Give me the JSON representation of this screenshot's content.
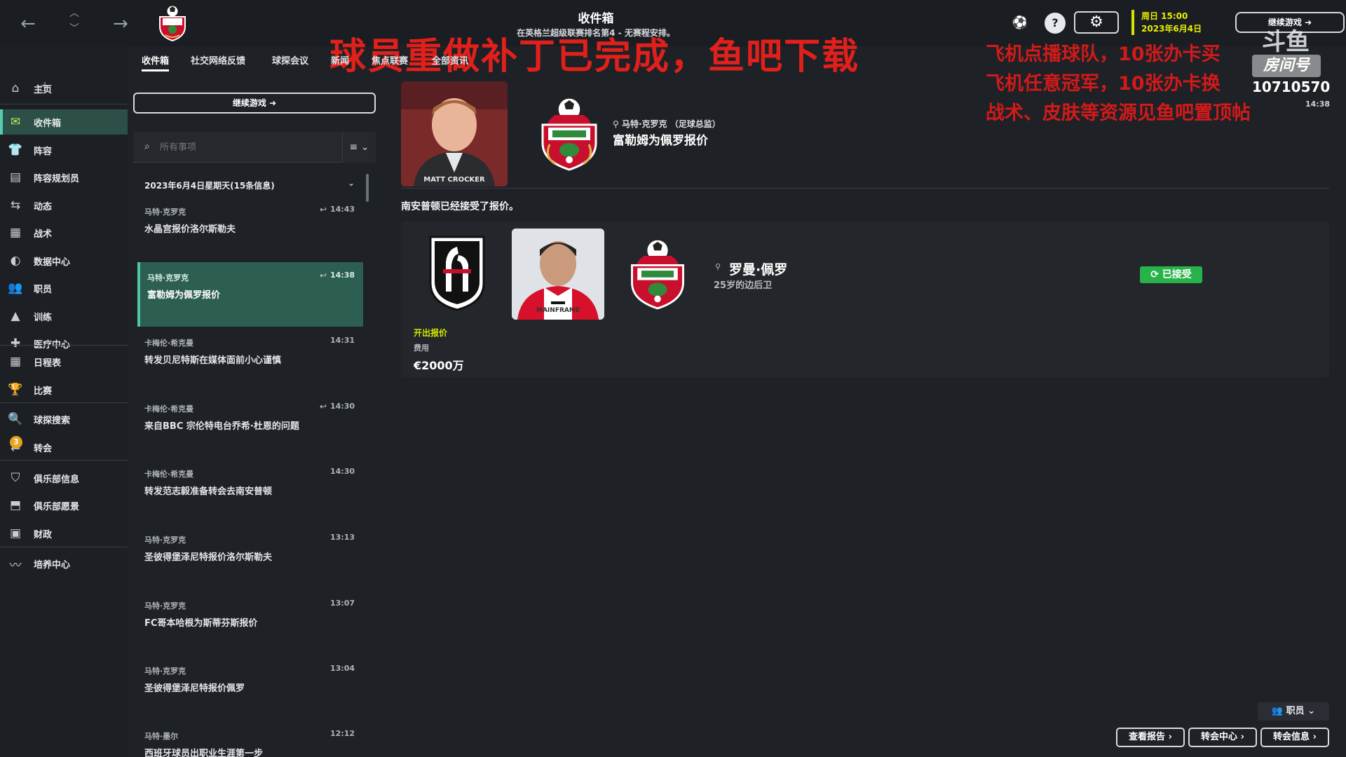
{
  "header": {
    "title": "收件箱",
    "subtitle": "在英格兰超级联赛排名第4 - 无赛程安排。",
    "date_line1": "周日 15:00",
    "date_line2": "2023年6月4日",
    "continue_label": "继续游戏",
    "help_label": "?",
    "icons": [
      "back-icon",
      "forward-icon",
      "up-icon",
      "down-icon",
      "club-crest-icon",
      "football-icon",
      "help-icon",
      "gear-icon"
    ]
  },
  "overlay": {
    "promo_main": "球员重做补丁已完成，鱼吧下载",
    "promo_lines": [
      "飞机点播球队，10张办卡买",
      "飞机任意冠军，10张办卡换",
      "战术、皮肤等资源见鱼吧置顶帖"
    ],
    "logo_text": "斗鱼",
    "room_label": "房间号",
    "room_number": "10710570",
    "room_time": "14:38"
  },
  "sidebar": {
    "items": [
      {
        "label": "主页",
        "icon": "home-icon"
      },
      {
        "label": "收件箱",
        "icon": "inbox-icon"
      },
      {
        "label": "阵容",
        "icon": "shirt-icon"
      },
      {
        "label": "阵容规划员",
        "icon": "clipboard-icon"
      },
      {
        "label": "动态",
        "icon": "dynamics-icon"
      },
      {
        "label": "战术",
        "icon": "tactics-icon"
      },
      {
        "label": "数据中心",
        "icon": "data-icon"
      },
      {
        "label": "职员",
        "icon": "staff-icon"
      },
      {
        "label": "训练",
        "icon": "training-icon"
      },
      {
        "label": "医疗中心",
        "icon": "medical-icon"
      },
      {
        "label": "日程表",
        "icon": "calendar-icon"
      },
      {
        "label": "比赛",
        "icon": "trophy-icon"
      },
      {
        "label": "球探搜索",
        "icon": "search-icon"
      },
      {
        "label": "转会",
        "icon": "transfer-icon",
        "badge": "3"
      },
      {
        "label": "俱乐部信息",
        "icon": "shield-icon"
      },
      {
        "label": "俱乐部愿景",
        "icon": "vision-icon"
      },
      {
        "label": "财政",
        "icon": "finance-icon"
      },
      {
        "label": "培养中心",
        "icon": "development-icon"
      }
    ]
  },
  "tabs": [
    "收件箱",
    "社交网络反馈",
    "球探会议",
    "新闻",
    "焦点联赛",
    "全部资讯"
  ],
  "inbox": {
    "continue_label": "继续游戏",
    "search_placeholder": "所有事项",
    "filter_label": "≡",
    "date_header": "2023年6月4日星期天(15条信息)",
    "messages": [
      {
        "sender": "马特·克罗克",
        "subject": "水晶宫报价洛尔斯勒夫",
        "time": "14:43",
        "reply": true
      },
      {
        "sender": "马特·克罗克",
        "subject": "富勒姆为佩罗报价",
        "time": "14:38",
        "reply": true,
        "active": true
      },
      {
        "sender": "卡梅伦·希克曼",
        "subject": "转发贝尼特斯在媒体面前小心谨慎",
        "time": "14:31",
        "reply": false
      },
      {
        "sender": "卡梅伦·希克曼",
        "subject": "来自BBC 宗伦特电台乔希·杜恩的问题",
        "time": "14:30",
        "reply": true
      },
      {
        "sender": "卡梅伦·希克曼",
        "subject": "转发范志毅准备转会去南安普顿",
        "time": "14:30",
        "reply": false
      },
      {
        "sender": "马特·克罗克",
        "subject": "圣彼得堡泽尼特报价洛尔斯勒夫",
        "time": "13:13",
        "reply": false
      },
      {
        "sender": "马特·克罗克",
        "subject": "FC哥本哈根为斯蒂芬斯报价",
        "time": "13:07",
        "reply": false
      },
      {
        "sender": "马特·克罗克",
        "subject": "圣彼得堡泽尼特报价佩罗",
        "time": "13:04",
        "reply": false
      },
      {
        "sender": "马特·墨尔",
        "subject": "西班牙球员出职业生涯第一步",
        "time": "12:12",
        "reply": false
      }
    ]
  },
  "detail": {
    "portrait_caption": "MATT CROCKER",
    "from": "马特·克罗克 （足球总监）",
    "title": "富勒姆为佩罗报价",
    "body": "南安普顿已经接受了报价。",
    "player_name": "罗曼·佩罗",
    "player_desc": "25岁的边后卫",
    "status": "已接受",
    "offer_label": "开出报价",
    "fee_label": "费用",
    "fee_value": "€2000万",
    "shirt_text": "MAINFRAME"
  },
  "footer": {
    "staff_label": "职员",
    "buttons": [
      "查看报告",
      "转会中心",
      "转会信息"
    ]
  },
  "colors": {
    "accent": "#4ec6a8",
    "accepted": "#27b24a",
    "date_yellow": "#e8ee00",
    "overlay_red": "#e1201c"
  }
}
